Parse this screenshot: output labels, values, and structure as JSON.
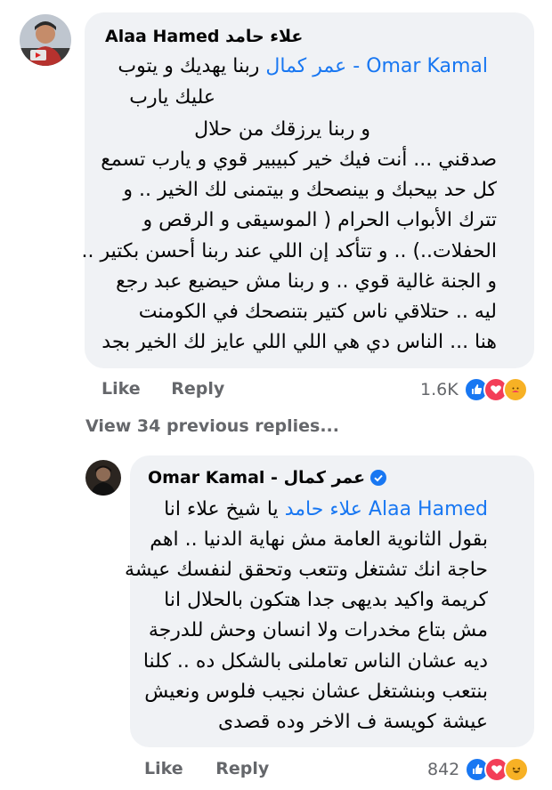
{
  "comment1": {
    "author": "Alaa Hamed علاء حامد",
    "mention": "Omar Kamal - عمر كمال",
    "mention_text": "ربنا يهديك و يتوب",
    "lines": [
      "عليك يارب",
      "و ربنا يرزقك من حلال",
      "صدقني ... أنت فيك خير كبيبير قوي و يارب تسمع",
      "كل حد بيحبك و بينصحك و بيتمنى لك الخير .. و",
      "تترك الأبواب الحرام ( الموسيقى و الرقص و",
      "الحفلات..) .. و تتأكد إن اللي عند ربنا أحسن بكتير ..",
      "و الجنة غالية قوي .. و ربنا مش حيضيع عبد رجع",
      "ليه .. حتلاقي ناس كتير بتنصحك في الكومنت",
      "هنا ... الناس دي هي اللي اللي عايز لك الخير بجد"
    ],
    "like_label": "Like",
    "reply_label": "Reply",
    "reaction_count": "1.6K"
  },
  "view_previous": "View 34 previous replies...",
  "comment2": {
    "author": "Omar Kamal - عمر كمال",
    "mention": "Alaa Hamed علاء حامد",
    "mention_text": "يا شيخ علاء انا",
    "lines": [
      "بقول الثانوية العامة مش نهاية الدنيا .. اهم",
      "حاجة انك تشتغل وتتعب وتحقق لنفسك عيشة",
      "كريمة واكيد بديهى جدا هتكون بالحلال انا",
      "مش بتاع مخدرات ولا انسان وحش للدرجة",
      "ديه عشان الناس تعاملنى بالشكل ده .. كلنا",
      "بنتعب وبنشتغل عشان نجيب فلوس ونعيش",
      "عيشة كويسة ف الاخر وده قصدى"
    ],
    "like_label": "Like",
    "reply_label": "Reply",
    "reaction_count": "842"
  },
  "colors": {
    "accent": "#1877f2",
    "bubble": "#f0f2f5",
    "muted": "#65676b"
  }
}
